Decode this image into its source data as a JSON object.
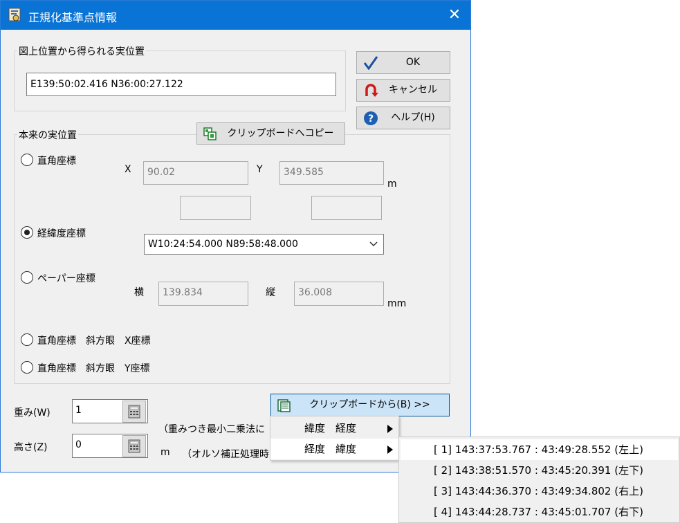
{
  "window": {
    "title": "正規化基準点情報"
  },
  "map_position": {
    "group_label": "図上位置から得られる実位置",
    "value": "E139:50:02.416 N36:00:27.122"
  },
  "buttons": {
    "ok": "OK",
    "cancel": "キャンセル",
    "help": "ヘルプ(H)",
    "copy_clipboard": "クリップボードへコピー",
    "from_clipboard": "クリップボードから(B) >>"
  },
  "actual_position": {
    "group_label": "本来の実位置",
    "rect": {
      "label": "直角座標",
      "x_label": "X",
      "x_value": "90.02",
      "y_label": "Y",
      "y_value": "349.585",
      "unit": "m"
    },
    "latlon": {
      "label": "経緯度座標",
      "value": "W10:24:54.000 N89:58:48.000"
    },
    "paper": {
      "label": "ペーパー座標",
      "h_label": "横",
      "h_value": "139.834",
      "v_label": "縦",
      "v_value": "36.008",
      "unit": "mm"
    },
    "rect_oblique_x": "直角座標　斜方眼　X座標",
    "rect_oblique_y": "直角座標　斜方眼　Y座標",
    "selected": "latlon"
  },
  "weight": {
    "label": "重み(W)",
    "value": "1",
    "note": "（重みつき最小二乗法に"
  },
  "height": {
    "label": "高さ(Z)",
    "value": "0",
    "unit": "m",
    "note": "（オルソ補正処理時"
  },
  "context_menu": {
    "items": [
      {
        "label": "緯度　経度"
      },
      {
        "label": "経度　緯度"
      }
    ]
  },
  "submenu": {
    "items": [
      "[ 1] 143:37:53.767 : 43:49:28.552 (左上)",
      "[ 2] 143:38:51.570 : 43:45:20.391 (左下)",
      "[ 3] 143:44:36.370 : 43:49:34.802 (右上)",
      "[ 4] 143:44:28.737 : 43:45:01.707 (右下)"
    ]
  }
}
